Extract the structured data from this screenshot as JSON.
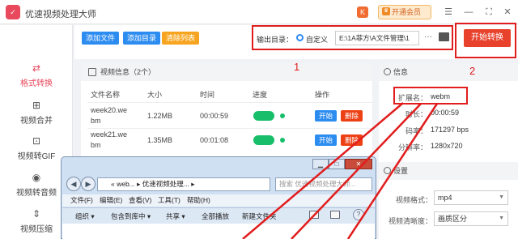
{
  "app": {
    "title": "优速视频处理大师",
    "logo_text": "✓",
    "vip_label": "开通会员",
    "badge": "K"
  },
  "sidebar": {
    "items": [
      {
        "label": "格式转换",
        "icon": "swap-icon",
        "glyph": "⇄",
        "active": true
      },
      {
        "label": "视频合并",
        "icon": "merge-icon",
        "glyph": "⊞",
        "active": false
      },
      {
        "label": "视频转GIF",
        "icon": "gif-icon",
        "glyph": "⊡",
        "active": false
      },
      {
        "label": "视频转音频",
        "icon": "audio-icon",
        "glyph": "◉",
        "active": false
      },
      {
        "label": "视频压缩",
        "icon": "compress-icon",
        "glyph": "⇕",
        "active": false
      }
    ]
  },
  "toolbar": {
    "add_file": "添加文件",
    "add_dir": "添加目录",
    "clear_list": "清除列表",
    "output_label": "输出目录：",
    "custom_label": "自定义",
    "output_path": "E:\\1A菲方\\A文件管理\\1",
    "more": "···",
    "start_convert": "开始转换"
  },
  "video_panel": {
    "title": "视频信息（2个）",
    "columns": [
      "文件名称",
      "大小",
      "时间",
      "进度",
      "操作"
    ],
    "rows": [
      {
        "name_line1": "week20.we",
        "name_line2": "bm",
        "size": "1.22MB",
        "time": "00:00:59"
      },
      {
        "name_line1": "week21.we",
        "name_line2": "bm",
        "size": "1.35MB",
        "time": "00:01:08"
      }
    ],
    "start_label": "开始",
    "delete_label": "删除"
  },
  "info_panel": {
    "title": "信息",
    "items": [
      {
        "key": "扩展名：",
        "value": "webm"
      },
      {
        "key": "时长：",
        "value": "00:00:59"
      },
      {
        "key": "码率：",
        "value": "171297 bps"
      },
      {
        "key": "分辨率：",
        "value": "1280x720"
      }
    ],
    "settings_title": "设置",
    "format_label": "视频格式：",
    "format_value": "mp4",
    "quality_label": "视频清晰度：",
    "quality_value": "画质区分"
  },
  "annotations": {
    "one": "1",
    "two": "2"
  },
  "explorer": {
    "address": "« web... ▸ 优速视频处理... ▸",
    "search_placeholder": "搜索 优速视频处理大师...",
    "menu": [
      "文件(F)",
      "编辑(E)",
      "查看(V)",
      "工具(T)",
      "帮助(H)"
    ],
    "commands": [
      "组织 ▾",
      "包含到库中 ▾",
      "共享 ▾",
      "全部播放",
      "新建文件夹"
    ]
  },
  "colors": {
    "accent": "#e8495d",
    "start_red": "#e8412c",
    "blue": "#2d8cf0",
    "orange": "#f7a520",
    "green": "#19be6b",
    "annotation": "#e11d1d"
  }
}
